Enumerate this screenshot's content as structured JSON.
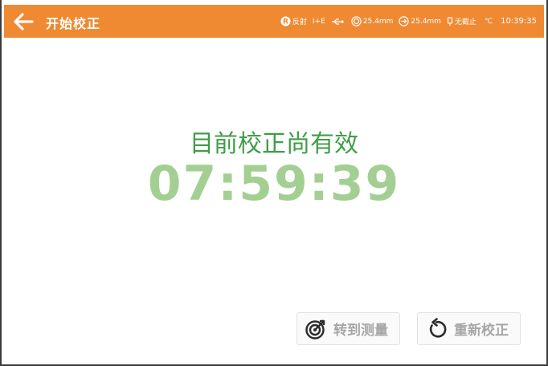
{
  "header": {
    "title": "开始校正",
    "status": {
      "reflect": "反射",
      "ie": "I+E",
      "size1": "25.4mm",
      "size2": "25.4mm",
      "cut": "无截止",
      "temp": "℃",
      "time": "10:39:35"
    }
  },
  "main": {
    "subtitle": "目前校正尚有效",
    "countdown": "07:59:39"
  },
  "buttons": {
    "go_measure": "转到测量",
    "recalibrate": "重新校正"
  },
  "colors": {
    "header_bg": "#ef8a33",
    "subtitle": "#3f9d48",
    "countdown": "#a3cf93",
    "button_text": "#a6a6a6"
  },
  "icons": {
    "back": "arrow-left-icon",
    "reflect": "r-badge-icon",
    "usb": "usb-icon",
    "aperture": "aperture-icon",
    "lens": "lens-icon",
    "cut": "filter-icon",
    "measure": "target-icon",
    "recal": "refresh-icon"
  }
}
